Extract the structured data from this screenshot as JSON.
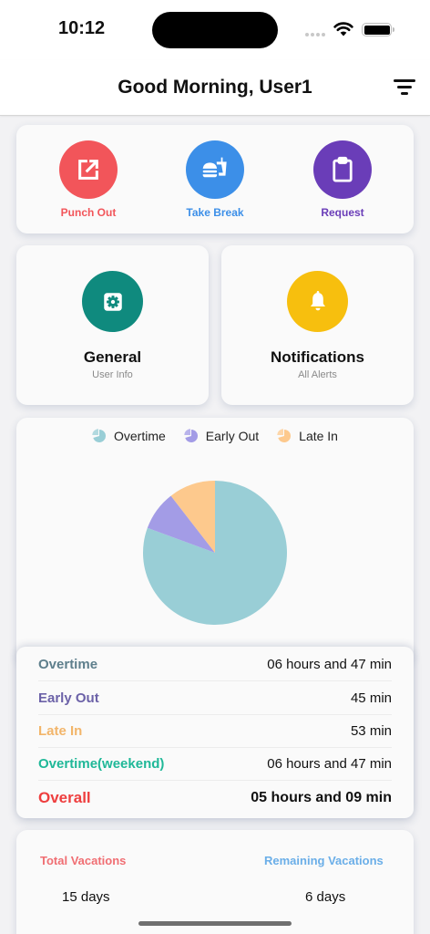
{
  "status_bar": {
    "time": "10:12"
  },
  "header": {
    "greeting": "Good Morning, User1"
  },
  "quick_actions": [
    {
      "label": "Punch Out",
      "color": "#f2555a",
      "icon": "external-link-icon"
    },
    {
      "label": "Take Break",
      "color": "#3c8fe8",
      "icon": "fastfood-icon"
    },
    {
      "label": "Request",
      "color": "#6a3db8",
      "icon": "clipboard-icon"
    }
  ],
  "tiles": [
    {
      "title": "General",
      "subtitle": "User Info",
      "color": "#0f8a7e",
      "icon": "settings-icon"
    },
    {
      "title": "Notifications",
      "subtitle": "All Alerts",
      "color": "#f7bf0e",
      "icon": "bell-icon"
    }
  ],
  "chart_data": {
    "type": "pie",
    "legend": [
      "Overtime",
      "Early Out",
      "Late In"
    ],
    "legend_placement": "top",
    "series": [
      {
        "name": "Overtime",
        "value": 407,
        "color": "#99ced6"
      },
      {
        "name": "Early Out",
        "value": 45,
        "color": "#a39ce6"
      },
      {
        "name": "Late In",
        "value": 53,
        "color": "#fdc98d"
      }
    ]
  },
  "stats": [
    {
      "label": "Overtime",
      "value": "06 hours and 47 min",
      "color": "#5e7f8c"
    },
    {
      "label": "Early Out",
      "value": "45 min",
      "color": "#6c62a8"
    },
    {
      "label": "Late In",
      "value": "53 min",
      "color": "#f2b56a"
    },
    {
      "label": "Overtime(weekend)",
      "value": "06 hours and 47 min",
      "color": "#1fb898"
    },
    {
      "label": "Overall",
      "value": "05 hours and 09 min",
      "color": "#ee3e3e"
    }
  ],
  "vacations": {
    "total_label": "Total Vacations",
    "total_value": "15 days",
    "total_color": "#f06e73",
    "remaining_label": "Remaining Vacations",
    "remaining_value": "6 days",
    "remaining_color": "#6aaee8"
  }
}
